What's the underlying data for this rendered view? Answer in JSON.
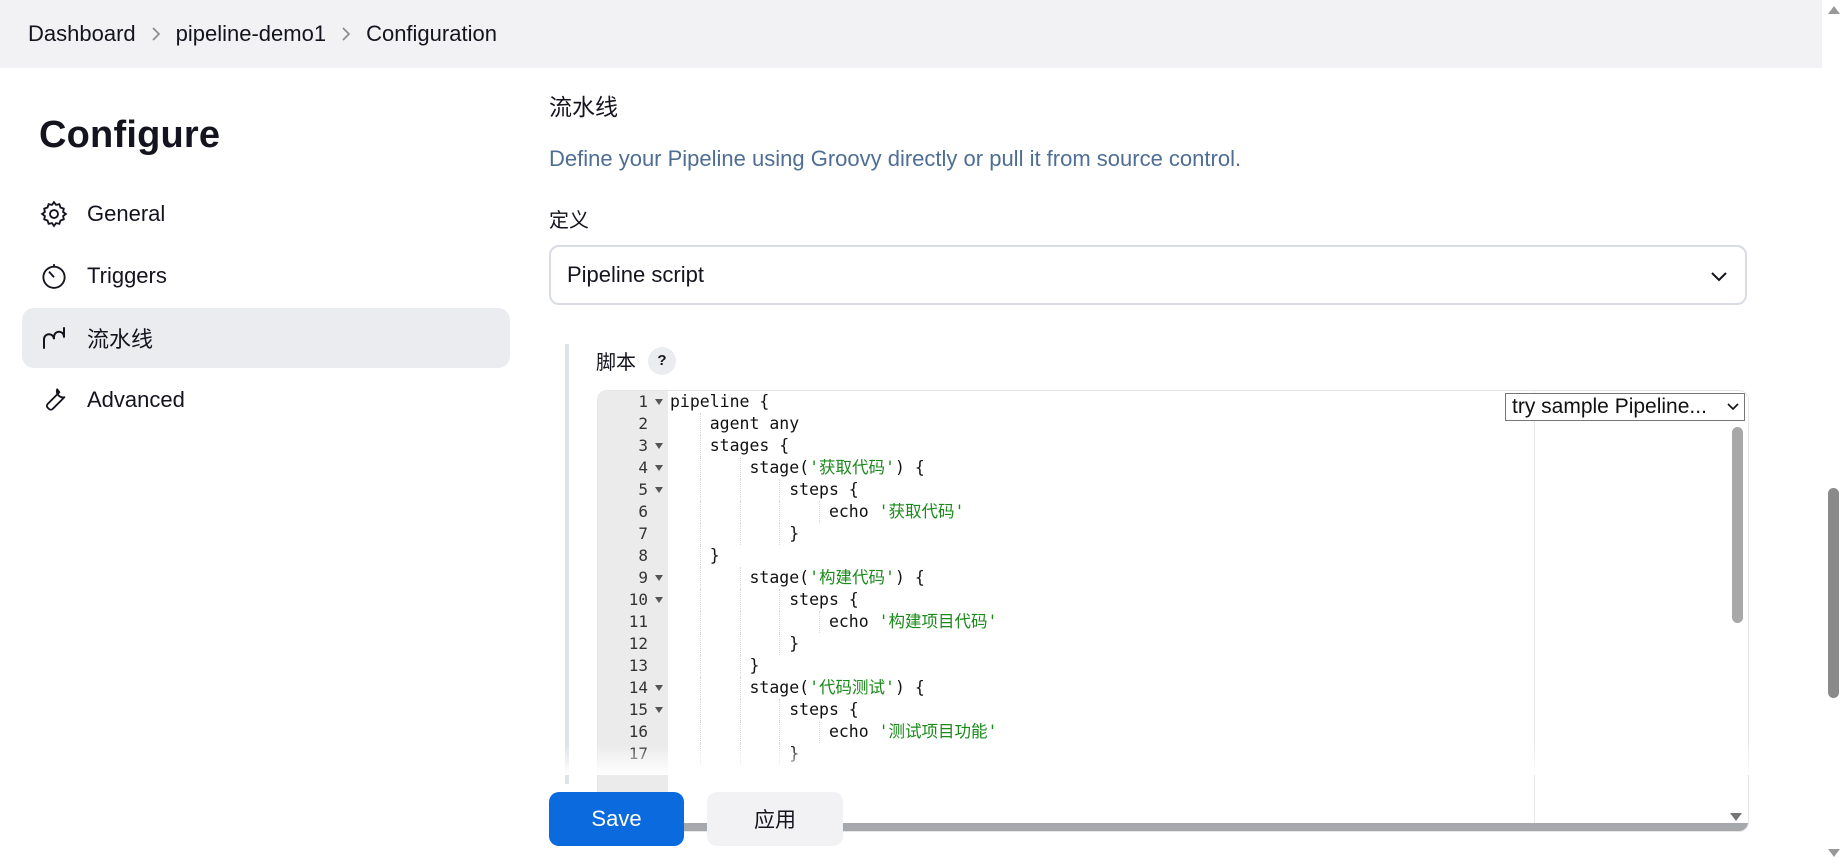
{
  "breadcrumb": [
    "Dashboard",
    "pipeline-demo1",
    "Configuration"
  ],
  "sidebar": {
    "title": "Configure",
    "items": [
      {
        "label": "General",
        "icon": "gear-icon"
      },
      {
        "label": "Triggers",
        "icon": "timer-icon"
      },
      {
        "label": "流水线",
        "icon": "pipeline-icon",
        "active": true
      },
      {
        "label": "Advanced",
        "icon": "wrench-icon"
      }
    ]
  },
  "main": {
    "section_title": "流水线",
    "description": "Define your Pipeline using Groovy directly or pull it from source control.",
    "definition_label": "定义",
    "definition_value": "Pipeline script",
    "script_label": "脚本",
    "help_label": "?",
    "sample_select": "try sample Pipeline...",
    "code_lines": [
      {
        "n": "1",
        "text": "pipeline {",
        "fold": true
      },
      {
        "n": "2",
        "text": "    agent any"
      },
      {
        "n": "3",
        "text": "    stages {",
        "fold": true
      },
      {
        "n": "4",
        "text": "        stage('获取代码') {",
        "fold": true
      },
      {
        "n": "5",
        "text": "            steps {",
        "fold": true
      },
      {
        "n": "6",
        "text": "                echo '获取代码'"
      },
      {
        "n": "7",
        "text": "            }"
      },
      {
        "n": "8",
        "text": "    }"
      },
      {
        "n": "9",
        "text": "        stage('构建代码') {",
        "fold": true
      },
      {
        "n": "10",
        "text": "            steps {",
        "fold": true
      },
      {
        "n": "11",
        "text": "                echo '构建项目代码'"
      },
      {
        "n": "12",
        "text": "            }"
      },
      {
        "n": "13",
        "text": "        }"
      },
      {
        "n": "14",
        "text": "        stage('代码测试') {",
        "fold": true
      },
      {
        "n": "15",
        "text": "            steps {",
        "fold": true
      },
      {
        "n": "16",
        "text": "                echo '测试项目功能'"
      },
      {
        "n": "17",
        "text": "            }"
      }
    ]
  },
  "buttons": {
    "save": "Save",
    "apply": "应用"
  },
  "colors": {
    "primary": "#0b6bde",
    "string": "#1a8a1a",
    "description": "#4f6e95"
  }
}
